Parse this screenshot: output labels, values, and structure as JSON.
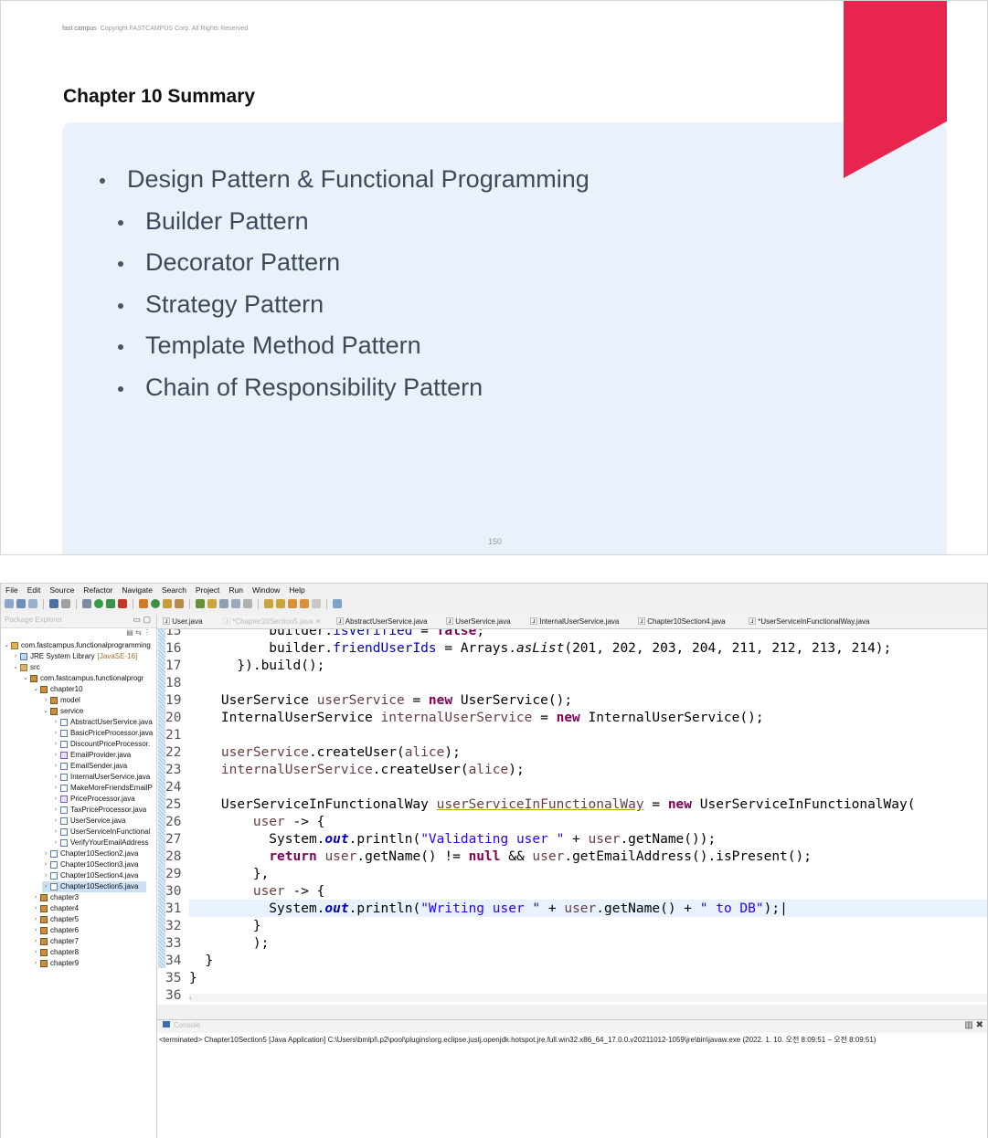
{
  "slide": {
    "brand": "fast campus",
    "copyright": "Copyright FASTCAMPUS Corp. All Rights Reserved",
    "title": "Chapter 10 Summary",
    "bullets": [
      "Design Pattern & Functional Programming",
      "Builder Pattern",
      "Decorator Pattern",
      "Strategy Pattern",
      "Template Method Pattern",
      "Chain of Responsibility Pattern"
    ],
    "page_number": "150",
    "accent_color": "#e8254e"
  },
  "ide": {
    "menu": [
      "File",
      "Edit",
      "Source",
      "Refactor",
      "Navigate",
      "Search",
      "Project",
      "Run",
      "Window",
      "Help"
    ],
    "package_explorer": {
      "tab_label": "Package Explorer",
      "tree": [
        {
          "label": "com.fastcampus.functionalprogramming",
          "extra": ""
        },
        {
          "label": "JRE System Library",
          "extra": "[JavaSE-16]"
        },
        {
          "label": "src",
          "extra": ""
        },
        {
          "label": "com.fastcampus.functionalprogr",
          "extra": ""
        },
        {
          "label": "chapter10",
          "extra": ""
        },
        {
          "label": "model",
          "extra": ""
        },
        {
          "label": "service",
          "extra": ""
        },
        {
          "label": "AbstractUserService.java",
          "extra": ""
        },
        {
          "label": "BasicPriceProcessor.java",
          "extra": ""
        },
        {
          "label": "DiscountPriceProcessor.",
          "extra": ""
        },
        {
          "label": "EmailProvider.java",
          "extra": ""
        },
        {
          "label": "EmailSender.java",
          "extra": ""
        },
        {
          "label": "InternalUserService.java",
          "extra": ""
        },
        {
          "label": "MakeMoreFriendsEmailP",
          "extra": ""
        },
        {
          "label": "PriceProcessor.java",
          "extra": ""
        },
        {
          "label": "TaxPriceProcessor.java",
          "extra": ""
        },
        {
          "label": "UserService.java",
          "extra": ""
        },
        {
          "label": "UserServiceInFunctional",
          "extra": ""
        },
        {
          "label": "VerifyYourEmailAddress",
          "extra": ""
        },
        {
          "label": "Chapter10Section2.java",
          "extra": ""
        },
        {
          "label": "Chapter10Section3.java",
          "extra": ""
        },
        {
          "label": "Chapter10Section4.java",
          "extra": ""
        },
        {
          "label": "Chapter10Section5.java",
          "extra": ""
        },
        {
          "label": "chapter3",
          "extra": ""
        },
        {
          "label": "chapter4",
          "extra": ""
        },
        {
          "label": "chapter5",
          "extra": ""
        },
        {
          "label": "chapter6",
          "extra": ""
        },
        {
          "label": "chapter7",
          "extra": ""
        },
        {
          "label": "chapter8",
          "extra": ""
        },
        {
          "label": "chapter9",
          "extra": ""
        }
      ]
    },
    "editor_tabs": [
      "User.java",
      "*Chapter10Section5.java",
      "AbstractUserService.java",
      "UserService.java",
      "InternalUserService.java",
      "Chapter10Section4.java",
      "*UserServiceInFunctionalWay.java"
    ],
    "line_numbers": [
      "15",
      "16",
      "17",
      "18",
      "19",
      "20",
      "21",
      "22",
      "23",
      "24",
      "25",
      "26",
      "27",
      "28",
      "29",
      "30",
      "31",
      "32",
      "33",
      "34",
      "35",
      "36"
    ],
    "console": {
      "tab_label": "Console",
      "output": "<terminated> Chapter10Section5 [Java Application] C:\\Users\\bmlpl\\.p2\\pool\\plugins\\org.eclipse.justj.openjdk.hotspot.jre.full.win32.x86_64_17.0.0.v20211012-1059\\jre\\bin\\javaw.exe  (2022. 1. 10. 오전 8:09:51 – 오전 8:09:51)"
    }
  }
}
